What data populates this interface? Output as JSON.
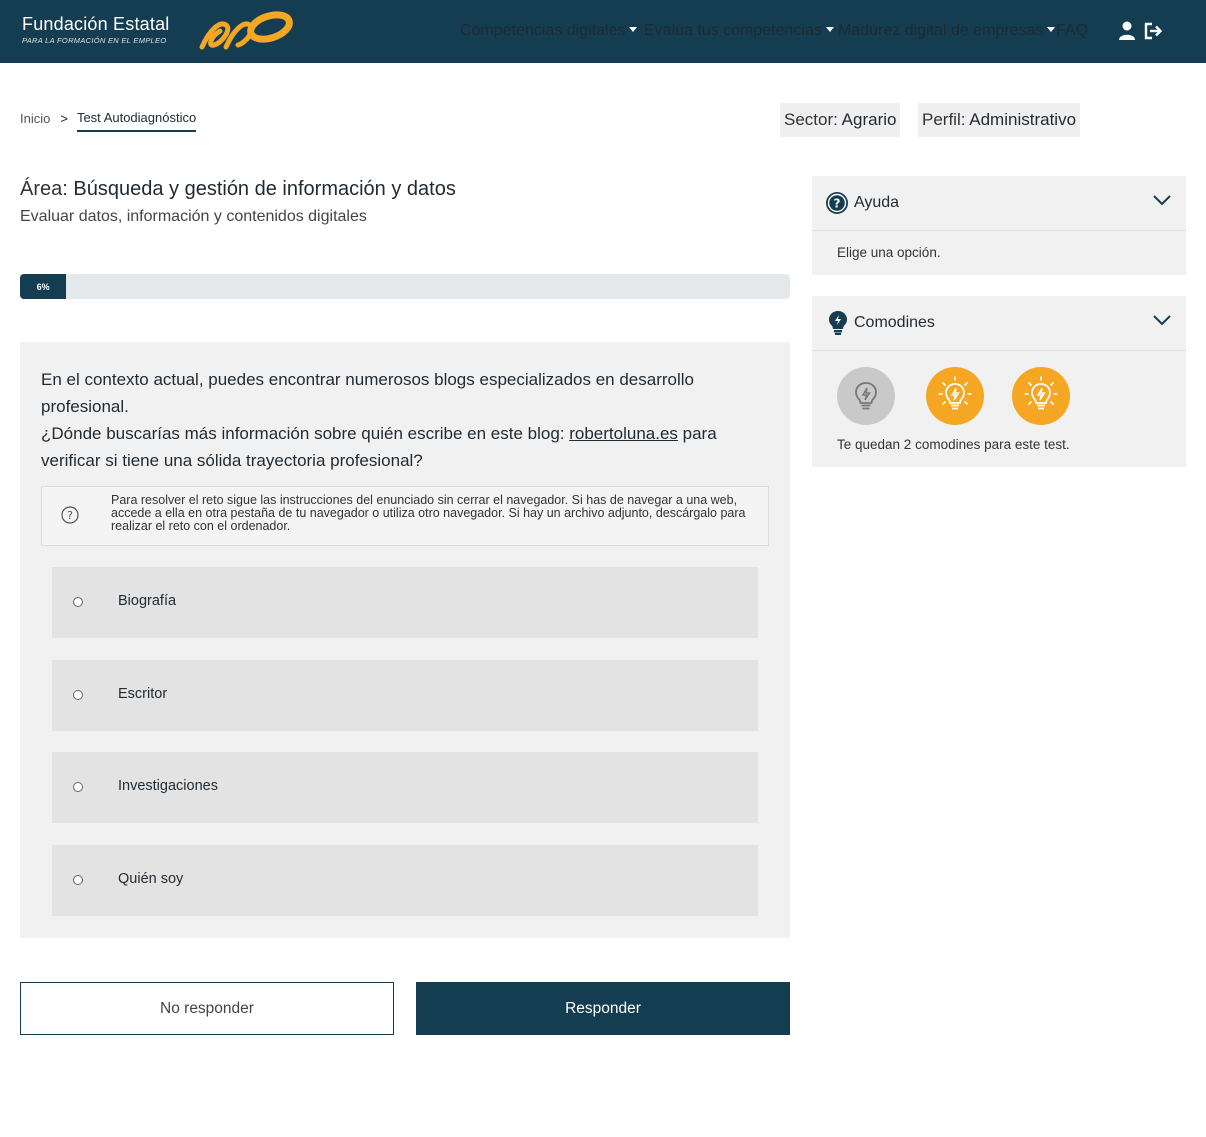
{
  "header": {
    "brand_name": "Fundación Estatal",
    "brand_sub": "PARA LA FORMACIÓN EN EL EMPLEO",
    "nav": [
      {
        "label": "Competencias digitales",
        "has_caret": true
      },
      {
        "label": "Evalúa tus competencias",
        "has_caret": true
      },
      {
        "label": "Madurez digital de empresas",
        "has_caret": true
      },
      {
        "label": "FAQ",
        "has_caret": false
      }
    ],
    "icons": [
      "user-icon",
      "logout-icon"
    ]
  },
  "breadcrumb": {
    "home": "Inicio",
    "separator": ">",
    "current": "Test Autodiagnóstico"
  },
  "profile": {
    "sector_label": "Sector:",
    "sector_value": "Agrario",
    "perfil_label": "Perfil:",
    "perfil_value": "Administrativo"
  },
  "area": {
    "label": "Área:",
    "value": "Búsqueda y gestión de información y datos",
    "subtitle": "Evaluar datos, información y contenidos digitales"
  },
  "progress": {
    "percent": 6,
    "label": "6%"
  },
  "question": {
    "line1": "En el contexto actual, puedes encontrar numerosos blogs especializados en desarrollo profesional.",
    "line2_pre": "¿Dónde buscarías más información sobre quién escribe en este blog: ",
    "link": "robertoluna.es",
    "line2_post": " para verificar si tiene una sólida trayectoria profesional?",
    "hint": "Para resolver el reto sigue las instrucciones del enunciado sin cerrar el navegador. Si has de navegar a una web, accede a ella en otra pestaña de tu navegador o utiliza otro navegador. Si hay un archivo adjunto, descárgalo para realizar el reto con el ordenador.",
    "options": [
      "Biografía",
      "Escritor",
      "Investigaciones",
      "Quién soy"
    ]
  },
  "buttons": {
    "skip": "No responder",
    "answer": "Responder"
  },
  "help_panel": {
    "title": "Ayuda",
    "text": "Elige una opción."
  },
  "wildcards_panel": {
    "title": "Comodines",
    "text": "Te quedan 2 comodines para este test.",
    "remaining": 2,
    "total": 3
  },
  "colors": {
    "primary": "#153d52",
    "accent": "#f5a623",
    "panel": "#f1f1f1",
    "used": "#c9c9c9"
  }
}
